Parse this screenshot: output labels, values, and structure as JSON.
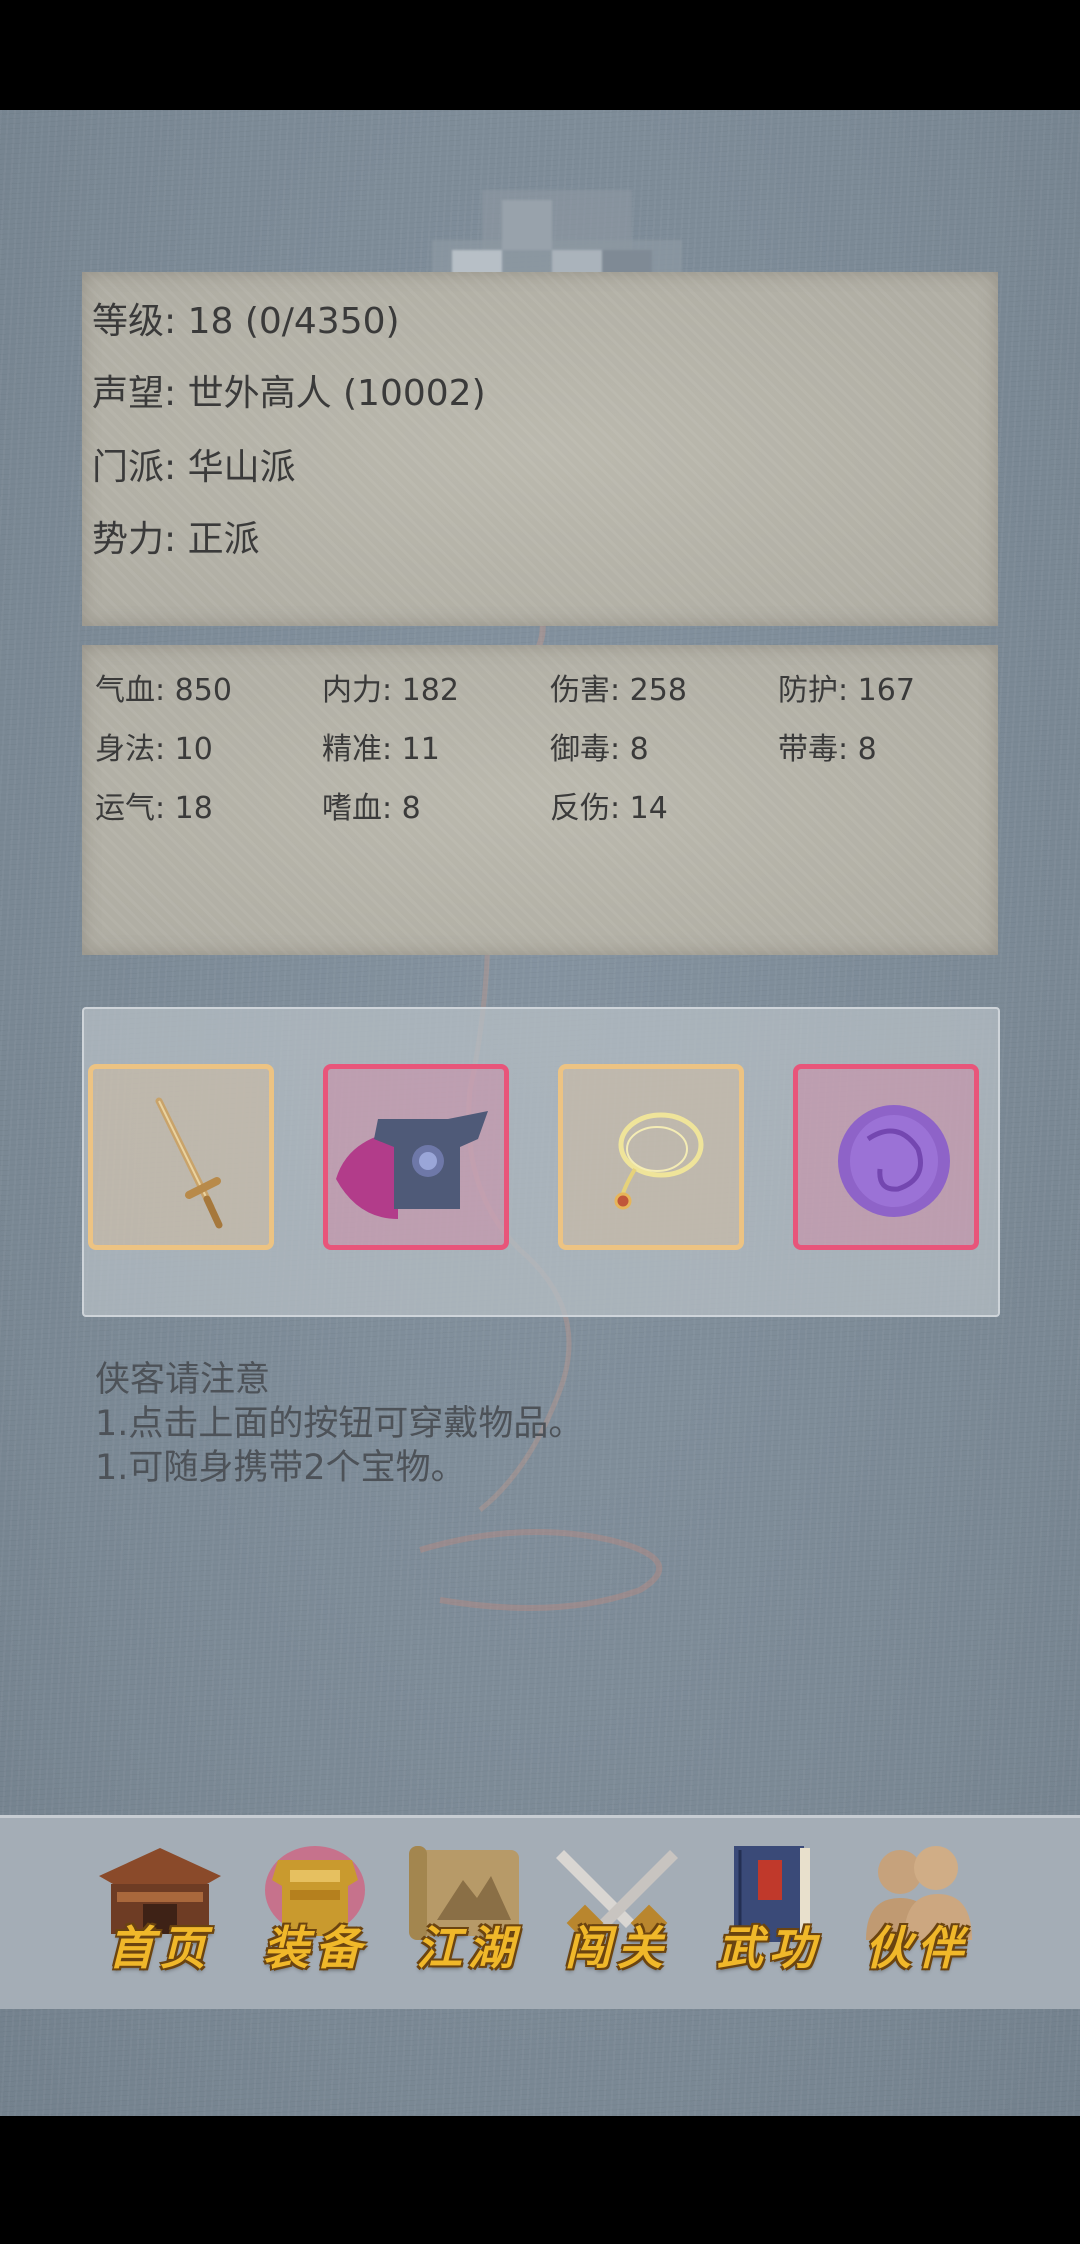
{
  "character": {
    "level_label": "等级: 18 (0/4350)",
    "reputation_label": "声望: 世外高人 (10002)",
    "sect_label": "门派: 华山派",
    "faction_label": "势力:  正派"
  },
  "stats": [
    {
      "text": "气血: 850"
    },
    {
      "text": "内力: 182"
    },
    {
      "text": "伤害: 258"
    },
    {
      "text": "防护: 167"
    },
    {
      "text": "身法: 10"
    },
    {
      "text": "精准: 11"
    },
    {
      "text": "御毒: 8"
    },
    {
      "text": "带毒: 8"
    },
    {
      "text": "运气: 18"
    },
    {
      "text": "嗜血: 8"
    },
    {
      "text": "反伤: 14"
    }
  ],
  "equipment": [
    {
      "icon": "sword-icon",
      "rarity_color": "#ecc383"
    },
    {
      "icon": "armor-icon",
      "rarity_color": "#e8557a"
    },
    {
      "icon": "necklace-icon",
      "rarity_color": "#ecc383"
    },
    {
      "icon": "purple-jade-icon",
      "rarity_color": "#e8557a"
    }
  ],
  "notice": {
    "title": "侠客请注意",
    "line1": "1.点击上面的按钮可穿戴物品。",
    "line2": "1.可随身携带2个宝物。"
  },
  "nav": [
    {
      "label": "首页",
      "icon": "house-icon"
    },
    {
      "label": "装备",
      "icon": "armor-icon"
    },
    {
      "label": "江湖",
      "icon": "scroll-map-icon"
    },
    {
      "label": "闯关",
      "icon": "crossed-swords-icon"
    },
    {
      "label": "武功",
      "icon": "book-icon"
    },
    {
      "label": "伙伴",
      "icon": "companions-icon"
    }
  ],
  "colors": {
    "background": "#7d8b97",
    "panel": "#b5b3a9",
    "nav_label": "#f0b82a",
    "rare_border": "#e8557a",
    "common_border": "#ecc383"
  }
}
